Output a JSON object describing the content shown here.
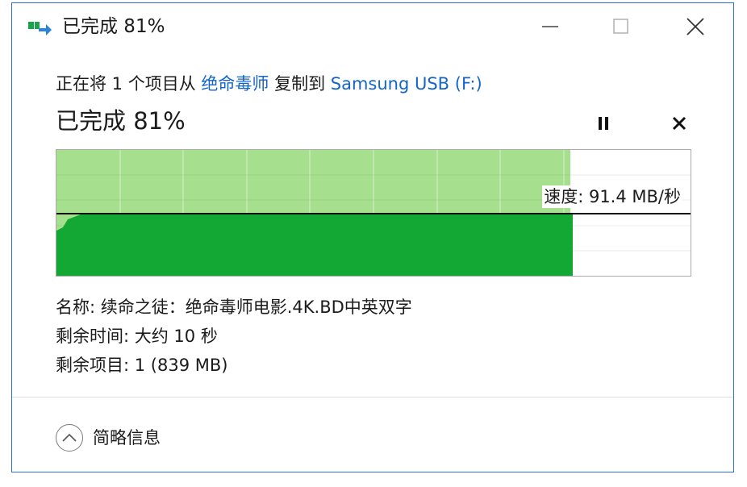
{
  "window": {
    "title": "已完成 81%",
    "icon": "copy-arrow-icon",
    "controls": [
      "minimize-icon",
      "maximize-icon",
      "close-icon"
    ],
    "border_color": "#2b6fd6"
  },
  "copy": {
    "prefix": "正在将 1 个项目从 ",
    "source": "绝命毒师",
    "middle": " 复制到 ",
    "destination": "Samsung USB (F:)",
    "link_color": "#1565c9"
  },
  "progress": {
    "label": "已完成 81%",
    "percent": 81
  },
  "actions": {
    "pause_icon": "pause-icon",
    "cancel_icon": "cancel-icon"
  },
  "speed": {
    "label": "速度: 91.4 MB/秒",
    "fill_color": "#a6e08f",
    "area_color": "#13a834"
  },
  "details": {
    "name": "名称: 续命之徒：绝命毒师电影.4K.BD中英双字",
    "time_remaining": "剩余时间: 大约 10 秒",
    "items_remaining": "剩余项目: 1 (839 MB)"
  },
  "footer": {
    "toggle_label": "简略信息",
    "toggle_icon": "chevron-up-icon"
  }
}
